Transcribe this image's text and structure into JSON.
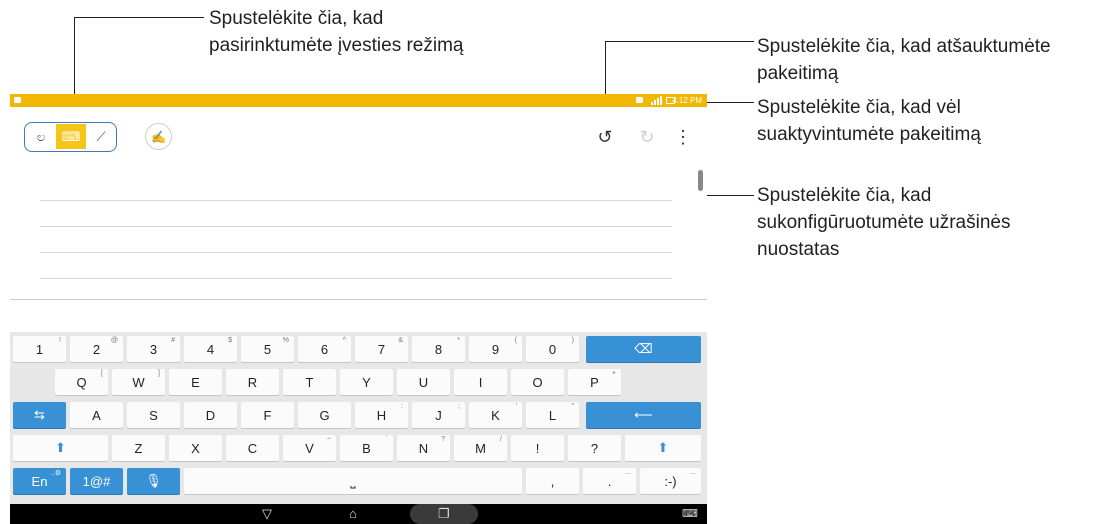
{
  "callouts": {
    "input_mode": {
      "line1": "Spustelėkite čia, kad",
      "line2": "pasirinktumėte įvesties režimą"
    },
    "undo": {
      "line1": "Spustelėkite čia, kad atšauktumėte",
      "line2": "pakeitimą"
    },
    "redo": {
      "line1": "Spustelėkite čia, kad vėl",
      "line2": "suaktyvintumėte pakeitimą"
    },
    "settings": {
      "line1": "Spustelėkite čia, kad",
      "line2": "sukonfigūruotumėte užrašinės",
      "line3": "nuostatas"
    }
  },
  "statusbar": {
    "time": "4:12 PM"
  },
  "toolbar": {
    "modes": [
      {
        "name": "handwriting",
        "icon": "handwriting-icon",
        "glyph": "ಲ"
      },
      {
        "name": "keyboard",
        "icon": "keyboard-icon",
        "glyph": "⌨"
      },
      {
        "name": "drawing",
        "icon": "brush-icon",
        "glyph": "⟋"
      }
    ],
    "active_mode": "keyboard",
    "pen_glyph": "✍",
    "undo_glyph": "↺",
    "redo_glyph": "↻",
    "menu_glyph": "⋮"
  },
  "keyboard": {
    "row1": [
      {
        "l": "1",
        "s": "!"
      },
      {
        "l": "2",
        "s": "@"
      },
      {
        "l": "3",
        "s": "#"
      },
      {
        "l": "4",
        "s": "$"
      },
      {
        "l": "5",
        "s": "%"
      },
      {
        "l": "6",
        "s": "^"
      },
      {
        "l": "7",
        "s": "&"
      },
      {
        "l": "8",
        "s": "*"
      },
      {
        "l": "9",
        "s": "("
      },
      {
        "l": "0",
        "s": ")"
      }
    ],
    "row2": [
      {
        "l": "Q",
        "s": "["
      },
      {
        "l": "W",
        "s": "]"
      },
      {
        "l": "E",
        "s": ""
      },
      {
        "l": "R",
        "s": ""
      },
      {
        "l": "T",
        "s": ""
      },
      {
        "l": "Y",
        "s": ""
      },
      {
        "l": "U",
        "s": ""
      },
      {
        "l": "I",
        "s": ""
      },
      {
        "l": "O",
        "s": ""
      },
      {
        "l": "P",
        "s": "+"
      }
    ],
    "row3": [
      {
        "l": "A",
        "s": ""
      },
      {
        "l": "S",
        "s": ""
      },
      {
        "l": "D",
        "s": ""
      },
      {
        "l": "F",
        "s": ""
      },
      {
        "l": "G",
        "s": ""
      },
      {
        "l": "H",
        "s": ":"
      },
      {
        "l": "J",
        "s": ";"
      },
      {
        "l": "K",
        "s": "'"
      },
      {
        "l": "L",
        "s": "\""
      }
    ],
    "row4": [
      {
        "l": "Z",
        "s": ""
      },
      {
        "l": "X",
        "s": ""
      },
      {
        "l": "C",
        "s": ""
      },
      {
        "l": "V",
        "s": "~"
      },
      {
        "l": "B",
        "s": "`"
      },
      {
        "l": "N",
        "s": "?"
      },
      {
        "l": "M",
        "s": "/"
      },
      {
        "l": "!",
        "s": ""
      },
      {
        "l": "?",
        "s": ""
      }
    ],
    "backspace_glyph": "⌫",
    "tab_glyph": "⇆",
    "enter_glyph": "⟵",
    "shift_glyph": "⬆",
    "lang_label": "En",
    "lang_sup": "..⚙",
    "symbols_label": "1@#",
    "mic_glyph": "🎙",
    "space_glyph": "⎵",
    "comma_label": ",",
    "period_label": ".",
    "period_sup": "...",
    "smiley_label": ":-)",
    "smiley_sup": "..."
  },
  "navbar": {
    "back_glyph": "▽",
    "home_glyph": "⌂",
    "recent_glyph": "❐",
    "kbd_glyph": "⌨"
  },
  "colors": {
    "statusbar": "#f2b705",
    "accent_blue": "#3891d5",
    "mode_active": "#f5c518"
  }
}
